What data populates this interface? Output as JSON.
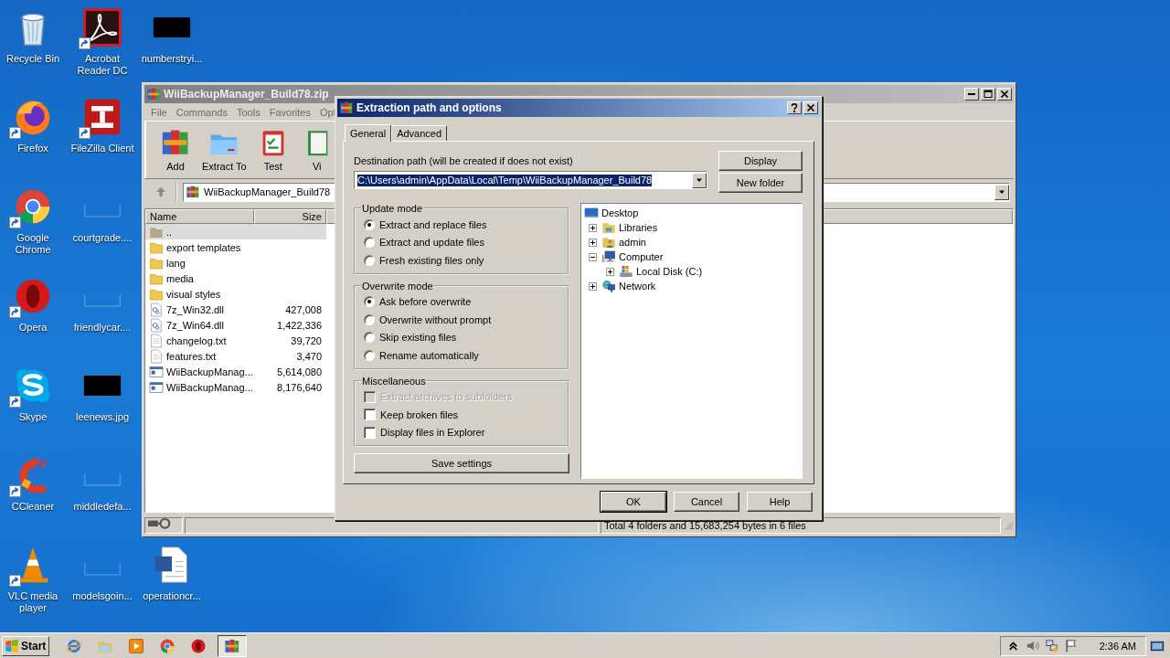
{
  "desktop_icons": [
    [
      {
        "label": "Recycle Bin",
        "kind": "recycle",
        "shortcut": false
      },
      {
        "label": "Acrobat Reader DC",
        "kind": "pdfapp",
        "shortcut": true
      },
      {
        "label": "numberstryi...",
        "kind": "thumb",
        "shortcut": false
      }
    ],
    [
      {
        "label": "Firefox",
        "kind": "firefox",
        "shortcut": true
      },
      {
        "label": "FileZilla Client",
        "kind": "filezilla",
        "shortcut": true
      }
    ],
    [
      {
        "label": "Google Chrome",
        "kind": "chrome",
        "shortcut": true
      },
      {
        "label": "courtgrade....",
        "kind": "blank",
        "shortcut": false
      }
    ],
    [
      {
        "label": "Opera",
        "kind": "opera",
        "shortcut": true
      },
      {
        "label": "friendlycar....",
        "kind": "blank",
        "shortcut": false
      }
    ],
    [
      {
        "label": "Skype",
        "kind": "skype",
        "shortcut": true
      },
      {
        "label": "leenews.jpg",
        "kind": "thumb",
        "shortcut": false
      }
    ],
    [
      {
        "label": "CCleaner",
        "kind": "ccleaner",
        "shortcut": true
      },
      {
        "label": "middledefa...",
        "kind": "blank",
        "shortcut": false
      }
    ],
    [
      {
        "label": "VLC media player",
        "kind": "vlc",
        "shortcut": true
      },
      {
        "label": "modelsgoin...",
        "kind": "blank",
        "shortcut": false
      },
      {
        "label": "operationcr...",
        "kind": "word",
        "shortcut": false
      }
    ]
  ],
  "archive_window": {
    "title": "WiiBackupManager_Build78.zip",
    "menu": [
      "File",
      "Commands",
      "Tools",
      "Favorites",
      "Opt"
    ],
    "toolbar": [
      {
        "label": "Add",
        "kind": "add"
      },
      {
        "label": "Extract To",
        "kind": "extract"
      },
      {
        "label": "Test",
        "kind": "test"
      },
      {
        "label": "Vi",
        "kind": "view"
      }
    ],
    "address": "WiiBackupManager_Build78",
    "columns": [
      "Name",
      "Size"
    ],
    "rows": [
      {
        "name": "..",
        "kind": "parent",
        "selected": true
      },
      {
        "name": "export templates",
        "kind": "folder",
        "selected": false
      },
      {
        "name": "lang",
        "kind": "folder",
        "selected": false
      },
      {
        "name": "media",
        "kind": "folder",
        "selected": false
      },
      {
        "name": "visual styles",
        "kind": "folder",
        "selected": false
      },
      {
        "name": "7z_Win32.dll",
        "size": "427,008",
        "kind": "dll",
        "selected": false
      },
      {
        "name": "7z_Win64.dll",
        "size": "1,422,336",
        "kind": "dll",
        "selected": false
      },
      {
        "name": "changelog.txt",
        "size": "39,720",
        "kind": "text",
        "selected": false
      },
      {
        "name": "features.txt",
        "size": "3,470",
        "kind": "text",
        "selected": false
      },
      {
        "name": "WiiBackupManag...",
        "size": "5,614,080",
        "kind": "exe",
        "selected": false
      },
      {
        "name": "WiiBackupManag...",
        "size": "8,176,640",
        "kind": "exe",
        "selected": false
      }
    ],
    "status": "Total 4 folders and 15,683,254 bytes in 6 files"
  },
  "dialog": {
    "title": "Extraction path and options",
    "tabs": [
      {
        "label": "General",
        "selected": true
      },
      {
        "label": "Advanced",
        "selected": false
      }
    ],
    "path_label": "Destination path (will be created if does not exist)",
    "path": "C:\\Users\\admin\\AppData\\Local\\Temp\\WiiBackupManager_Build78",
    "side_buttons": [
      "Display",
      "New folder"
    ],
    "groups": [
      {
        "title": "Update mode",
        "options": [
          {
            "label": "Extract and replace files",
            "kind": "radio",
            "selected": true,
            "disabled": false
          },
          {
            "label": "Extract and update files",
            "kind": "radio",
            "selected": false,
            "disabled": false
          },
          {
            "label": "Fresh existing files only",
            "kind": "radio",
            "selected": false,
            "disabled": false
          }
        ]
      },
      {
        "title": "Overwrite mode",
        "options": [
          {
            "label": "Ask before overwrite",
            "kind": "radio",
            "selected": true,
            "disabled": false
          },
          {
            "label": "Overwrite without prompt",
            "kind": "radio",
            "selected": false,
            "disabled": false
          },
          {
            "label": "Skip existing files",
            "kind": "radio",
            "selected": false,
            "disabled": false
          },
          {
            "label": "Rename automatically",
            "kind": "radio",
            "selected": false,
            "disabled": false
          }
        ]
      },
      {
        "title": "Miscellaneous",
        "options": [
          {
            "label": "Extract archives to subfolders",
            "kind": "checkbox",
            "checked": false,
            "disabled": true
          },
          {
            "label": "Keep broken files",
            "kind": "checkbox",
            "checked": false,
            "disabled": false
          },
          {
            "label": "Display files in Explorer",
            "kind": "checkbox",
            "checked": false,
            "disabled": false
          }
        ]
      }
    ],
    "save_button": "Save settings",
    "tree": [
      {
        "label": "Desktop",
        "kind": "desktop",
        "children": [
          {
            "label": "Libraries",
            "kind": "libraries",
            "expanded": false
          },
          {
            "label": "admin",
            "kind": "user",
            "expanded": false
          },
          {
            "label": "Computer",
            "kind": "computer",
            "expanded": true,
            "children": [
              {
                "label": "Local Disk (C:)",
                "kind": "drive",
                "expanded": false
              }
            ]
          },
          {
            "label": "Network",
            "kind": "network",
            "expanded": false
          }
        ]
      }
    ],
    "buttons": [
      "OK",
      "Cancel",
      "Help"
    ]
  },
  "taskbar": {
    "start": "Start",
    "apps": [
      {
        "kind": "ie",
        "active": false
      },
      {
        "kind": "explorer",
        "active": false
      },
      {
        "kind": "media",
        "active": false
      },
      {
        "kind": "chrome",
        "active": false
      },
      {
        "kind": "opera",
        "active": false
      },
      {
        "kind": "add",
        "active": true
      }
    ],
    "clock": "2:36 AM"
  }
}
